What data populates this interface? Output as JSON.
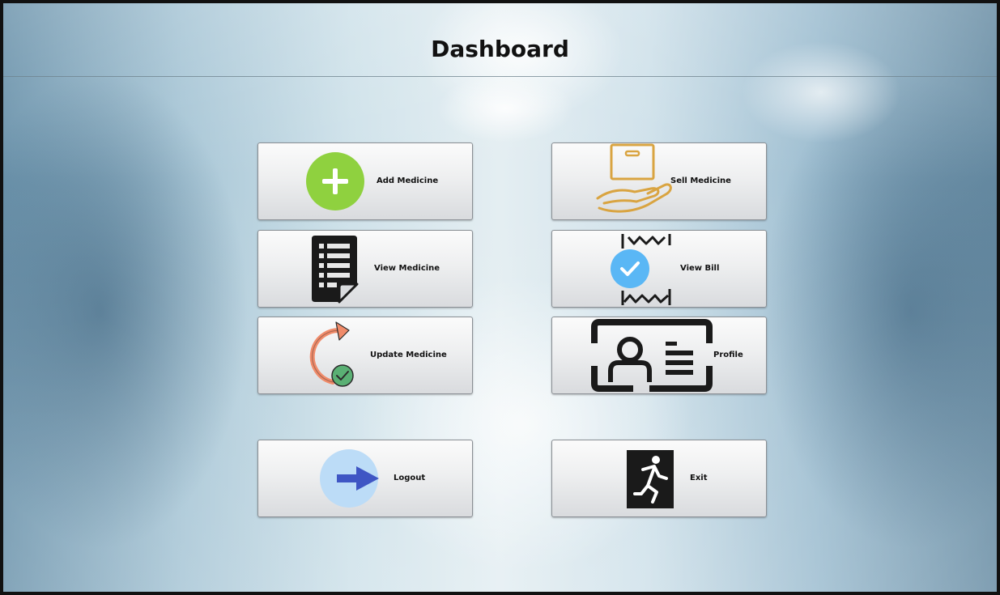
{
  "page": {
    "title": "Dashboard"
  },
  "buttons": {
    "add_medicine": {
      "label": "Add Medicine",
      "icon": "plus-circle-icon"
    },
    "sell_medicine": {
      "label": "Sell Medicine",
      "icon": "box-in-hand-icon"
    },
    "view_medicine": {
      "label": "View Medicine",
      "icon": "document-list-icon"
    },
    "view_bill": {
      "label": "View Bill",
      "icon": "receipt-check-icon"
    },
    "update_medicine": {
      "label": "Update Medicine",
      "icon": "refresh-check-icon"
    },
    "profile": {
      "label": "Profile",
      "icon": "id-card-icon"
    },
    "logout": {
      "label": "Logout",
      "icon": "arrow-right-icon"
    },
    "exit": {
      "label": "Exit",
      "icon": "running-exit-icon"
    }
  },
  "colors": {
    "plus_green": "#8fd13f",
    "box_gold": "#d9a441",
    "check_blue": "#5ab7f5",
    "refresh_salmon": "#f08b6a",
    "check_green": "#5ab074",
    "logout_circle": "#bcdcf7",
    "logout_arrow": "#3f56c4",
    "dark_icon": "#1a1a1a"
  }
}
